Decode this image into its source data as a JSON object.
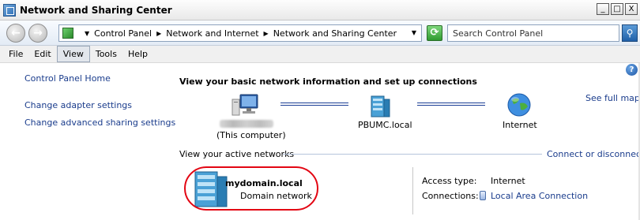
{
  "window": {
    "title": "Network and Sharing Center",
    "controls": {
      "minimize": "_",
      "maximize": "□",
      "close": "X"
    }
  },
  "address": {
    "breadcrumbs": [
      "Control Panel",
      "Network and Internet",
      "Network and Sharing Center"
    ],
    "search_placeholder": "Search Control Panel"
  },
  "menu": [
    "File",
    "Edit",
    "View",
    "Tools",
    "Help"
  ],
  "menu_active": "View",
  "left_nav": {
    "home": "Control Panel Home",
    "links": [
      "Change adapter settings",
      "Change advanced sharing settings"
    ]
  },
  "main": {
    "heading": "View your basic network information and set up connections",
    "see_full_map": "See full map",
    "nodes": [
      {
        "name": "",
        "caption": "(This computer)",
        "icon": "computer-icon"
      },
      {
        "name": "PBUMC.local",
        "icon": "server-icon"
      },
      {
        "name": "Internet",
        "icon": "globe-icon"
      }
    ],
    "active_networks_title": "View your active networks",
    "connect_link": "Connect or disconnect",
    "network": {
      "name": "mydomain.local",
      "type": "Domain network",
      "access_type_label": "Access type:",
      "access_type_value": "Internet",
      "connections_label": "Connections:",
      "connections_value": "Local Area Connection"
    }
  },
  "colors": {
    "link": "#1a3c8c",
    "highlight": "#e30613",
    "connector": "#1c3f96"
  }
}
